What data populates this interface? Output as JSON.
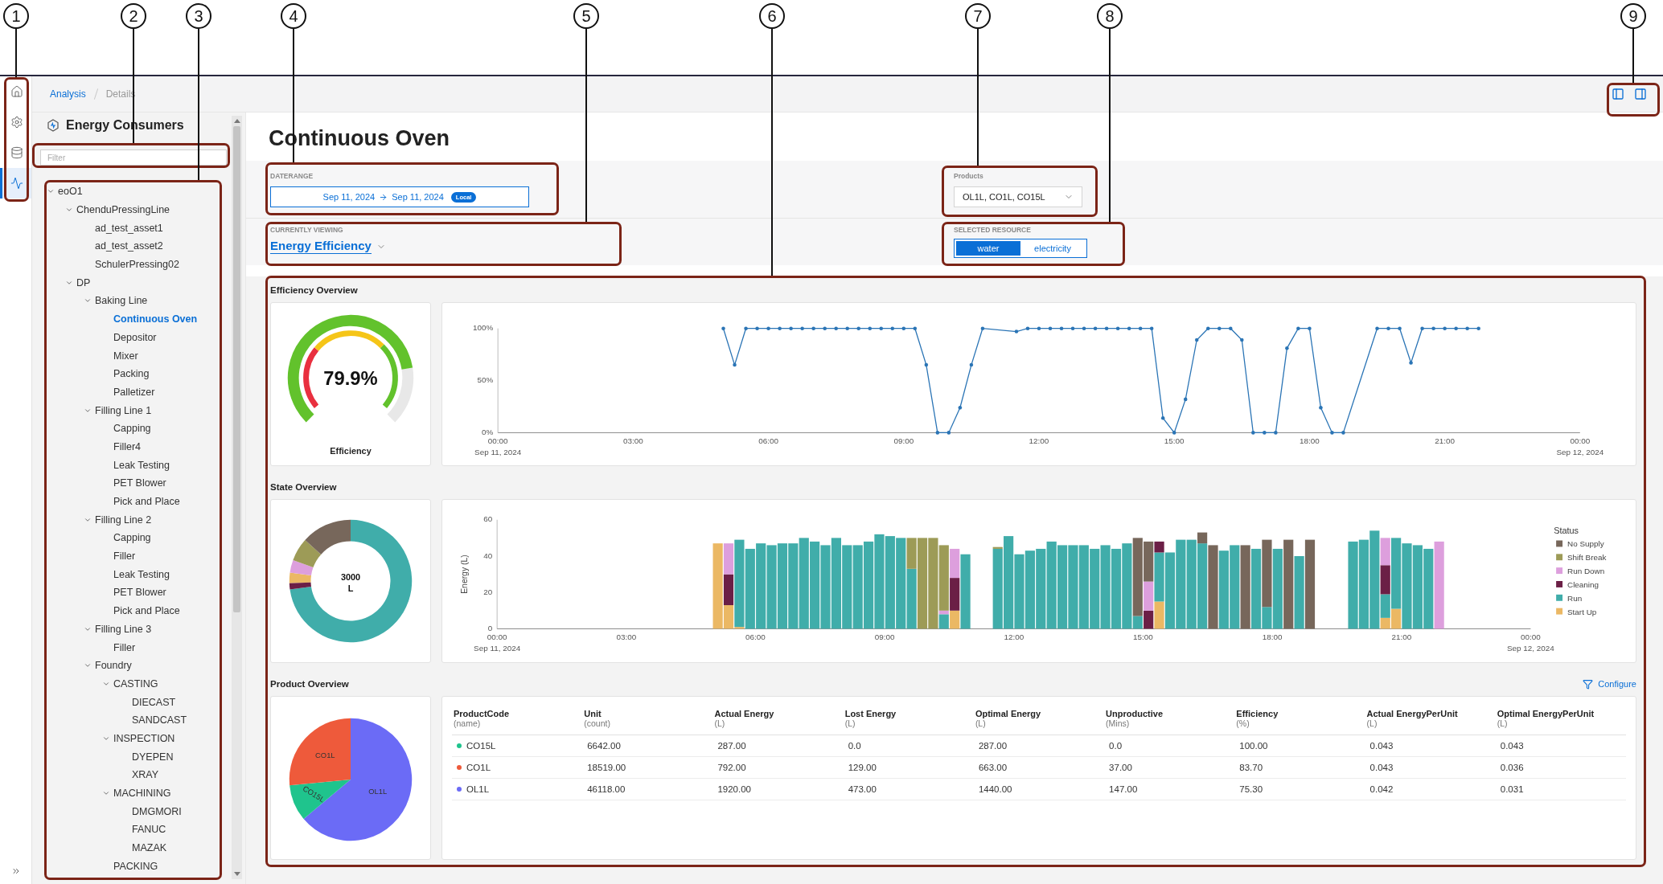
{
  "callouts": [
    {
      "number": "1"
    },
    {
      "number": "2"
    },
    {
      "number": "3"
    },
    {
      "number": "4"
    },
    {
      "number": "5"
    },
    {
      "number": "6"
    },
    {
      "number": "7"
    },
    {
      "number": "8"
    },
    {
      "number": "9"
    }
  ],
  "nav_rail": {
    "items": [
      {
        "selected": false
      },
      {
        "selected": false
      },
      {
        "selected": false
      },
      {
        "selected": true
      }
    ]
  },
  "breadcrumb": [
    {
      "label": "Analysis",
      "current": false
    },
    {
      "label": "Details",
      "current": true
    }
  ],
  "sidebar": {
    "title": "Energy Consumers",
    "filter": {
      "placeholder": "Filter"
    },
    "tree": [
      {
        "label": "eoO1",
        "expanded": true,
        "selected": false,
        "children": [
          {
            "label": "ChenduPressingLine",
            "expanded": true,
            "selected": false,
            "children": [
              {
                "label": "ad_test_asset1",
                "selected": false
              },
              {
                "label": "ad_test_asset2",
                "selected": false
              },
              {
                "label": "SchulerPressing02",
                "selected": false
              }
            ]
          },
          {
            "label": "DP",
            "expanded": true,
            "selected": false,
            "children": [
              {
                "label": "Baking Line",
                "expanded": true,
                "selected": false,
                "children": [
                  {
                    "label": "Continuous Oven",
                    "selected": true
                  },
                  {
                    "label": "Depositor",
                    "selected": false
                  },
                  {
                    "label": "Mixer",
                    "selected": false
                  },
                  {
                    "label": "Packing",
                    "selected": false
                  },
                  {
                    "label": "Palletizer",
                    "selected": false
                  }
                ]
              },
              {
                "label": "Filling Line 1",
                "expanded": true,
                "selected": false,
                "children": [
                  {
                    "label": "Capping",
                    "selected": false
                  },
                  {
                    "label": "Filler4",
                    "selected": false
                  },
                  {
                    "label": "Leak Testing",
                    "selected": false
                  },
                  {
                    "label": "PET Blower",
                    "selected": false
                  },
                  {
                    "label": "Pick and Place",
                    "selected": false
                  }
                ]
              },
              {
                "label": "Filling Line 2",
                "expanded": true,
                "selected": false,
                "children": [
                  {
                    "label": "Capping",
                    "selected": false
                  },
                  {
                    "label": "Filler",
                    "selected": false
                  },
                  {
                    "label": "Leak Testing",
                    "selected": false
                  },
                  {
                    "label": "PET Blower",
                    "selected": false
                  },
                  {
                    "label": "Pick and Place",
                    "selected": false
                  }
                ]
              },
              {
                "label": "Filling Line 3",
                "expanded": true,
                "selected": false,
                "children": [
                  {
                    "label": "Filler",
                    "selected": false
                  }
                ]
              },
              {
                "label": "Foundry",
                "expanded": true,
                "selected": false,
                "children": [
                  {
                    "label": "CASTING",
                    "expanded": true,
                    "selected": false,
                    "children": [
                      {
                        "label": "DIECAST",
                        "selected": false
                      },
                      {
                        "label": "SANDCAST",
                        "selected": false
                      }
                    ]
                  },
                  {
                    "label": "INSPECTION",
                    "expanded": true,
                    "selected": false,
                    "children": [
                      {
                        "label": "DYEPEN",
                        "selected": false
                      },
                      {
                        "label": "XRAY",
                        "selected": false
                      }
                    ]
                  },
                  {
                    "label": "MACHINING",
                    "expanded": true,
                    "selected": false,
                    "children": [
                      {
                        "label": "DMGMORI",
                        "selected": false
                      },
                      {
                        "label": "FANUC",
                        "selected": false
                      },
                      {
                        "label": "MAZAK",
                        "selected": false
                      }
                    ]
                  },
                  {
                    "label": "PACKING",
                    "selected": false
                  }
                ]
              }
            ]
          }
        ]
      }
    ]
  },
  "page": {
    "title": "Continuous Oven"
  },
  "filters": {
    "daterange": {
      "label": "DATERANGE",
      "start": "Sep 11, 2024",
      "end": "Sep 11, 2024",
      "badge": "Local"
    },
    "products": {
      "label": "Products",
      "value": "OL1L, CO1L, CO15L"
    },
    "viewing": {
      "label": "CURRENTLY VIEWING",
      "value": "Energy Efficiency"
    },
    "resource": {
      "label": "SELECTED RESOURCE",
      "options": [
        {
          "label": "water",
          "selected": true
        },
        {
          "label": "electricity",
          "selected": false
        }
      ]
    }
  },
  "efficiency_overview": {
    "title": "Efficiency Overview",
    "gauge": {
      "value": "79.9%",
      "label": "Efficiency"
    },
    "date_labels": [
      "Sep 11, 2024",
      "Sep 12, 2024"
    ],
    "chart_data": {
      "type": "line",
      "xlim": [
        0,
        24
      ],
      "ylim": [
        0,
        100
      ],
      "xticks": [
        {
          "value": 0,
          "label": "00:00"
        },
        {
          "value": 3,
          "label": "03:00"
        },
        {
          "value": 6,
          "label": "06:00"
        },
        {
          "value": 9,
          "label": "09:00"
        },
        {
          "value": 12,
          "label": "12:00"
        },
        {
          "value": 15,
          "label": "15:00"
        },
        {
          "value": 18,
          "label": "18:00"
        },
        {
          "value": 21,
          "label": "21:00"
        },
        {
          "value": 24,
          "label": "00:00"
        }
      ],
      "yticks": [
        {
          "value": 0,
          "label": "0%"
        },
        {
          "value": 50,
          "label": "50%"
        },
        {
          "value": 100,
          "label": "100%"
        }
      ],
      "x": [
        5,
        5.25,
        5.5,
        5.75,
        6,
        6.25,
        6.5,
        6.75,
        7,
        7.25,
        7.5,
        7.75,
        8,
        8.25,
        8.5,
        8.75,
        9,
        9.25,
        9.5,
        9.75,
        10,
        10.25,
        10.5,
        10.75,
        11.5,
        11.75,
        12,
        12.25,
        12.5,
        12.75,
        13,
        13.25,
        13.5,
        13.75,
        14,
        14.25,
        14.5,
        14.75,
        15,
        15.25,
        15.5,
        15.75,
        16,
        16.25,
        16.5,
        16.75,
        17,
        17.25,
        17.5,
        17.75,
        18,
        18.25,
        18.5,
        18.75,
        19.5,
        19.75,
        20,
        20.25,
        20.5,
        20.75,
        21,
        21.25,
        21.5,
        21.75
      ],
      "series": [
        {
          "color": "#2a74b5",
          "values": [
            100,
            65,
            100,
            100,
            100,
            100,
            100,
            100,
            100,
            100,
            100,
            100,
            100,
            100,
            100,
            100,
            100,
            100,
            65,
            0,
            0,
            24,
            65,
            100,
            97,
            100,
            100,
            100,
            100,
            100,
            100,
            100,
            100,
            100,
            100,
            100,
            100,
            14,
            0,
            32,
            89,
            100,
            100,
            100,
            89,
            0,
            0,
            0,
            81,
            100,
            100,
            24,
            0,
            0,
            100,
            100,
            100,
            67,
            100,
            100,
            100,
            100,
            100,
            100
          ]
        }
      ]
    }
  },
  "state_overview": {
    "title": "State Overview",
    "donut": {
      "value": "3000",
      "unit": "L"
    },
    "date_labels": [
      "Sep 11, 2024",
      "Sep 12, 2024"
    ],
    "chart_data": {
      "type": "bar",
      "stacked": true,
      "ylabel": "Energy (L)",
      "legend": {
        "title": "Status"
      },
      "xlim": [
        0,
        24
      ],
      "ylim": [
        0,
        60
      ],
      "xticks": [
        {
          "value": 0,
          "label": "00:00"
        },
        {
          "value": 3,
          "label": "03:00"
        },
        {
          "value": 6,
          "label": "06:00"
        },
        {
          "value": 9,
          "label": "09:00"
        },
        {
          "value": 12,
          "label": "12:00"
        },
        {
          "value": 15,
          "label": "15:00"
        },
        {
          "value": 18,
          "label": "18:00"
        },
        {
          "value": 21,
          "label": "21:00"
        },
        {
          "value": 24,
          "label": "00:00"
        }
      ],
      "yticks": [
        0,
        20,
        40,
        60
      ],
      "x": [
        5.125,
        5.375,
        5.625,
        5.875,
        6.125,
        6.375,
        6.625,
        6.875,
        7.125,
        7.375,
        7.625,
        7.875,
        8.125,
        8.375,
        8.625,
        8.875,
        9.125,
        9.375,
        9.625,
        9.875,
        10.125,
        10.375,
        10.625,
        10.875,
        11.625,
        11.875,
        12.125,
        12.375,
        12.625,
        12.875,
        13.125,
        13.375,
        13.625,
        13.875,
        14.125,
        14.375,
        14.625,
        14.875,
        15.125,
        15.375,
        15.625,
        15.875,
        16.125,
        16.375,
        16.625,
        16.875,
        17.125,
        17.375,
        17.625,
        17.875,
        18.125,
        18.375,
        18.625,
        18.875,
        19.875,
        20.125,
        20.375,
        20.625,
        20.875,
        21.125,
        21.375,
        21.625,
        21.875
      ],
      "series": [
        {
          "name": "Start Up",
          "color": "#ebb864",
          "values": [
            47,
            13,
            1,
            0,
            0,
            0,
            0,
            0,
            0,
            0,
            0,
            0,
            0,
            0,
            0,
            0,
            0,
            0,
            0,
            0,
            0,
            0,
            10,
            0,
            0,
            0,
            0,
            0,
            0,
            0,
            0,
            0,
            0,
            0,
            0,
            0,
            0,
            0,
            0,
            15,
            0,
            0,
            0,
            0,
            0,
            0,
            0,
            0,
            0,
            0,
            0,
            0,
            0,
            0,
            0,
            0,
            0,
            6,
            11,
            0,
            0,
            0,
            0
          ]
        },
        {
          "name": "Run",
          "color": "#40adaa",
          "values": [
            0,
            0,
            48,
            44,
            47,
            46,
            47,
            47,
            50,
            48,
            46,
            50,
            46,
            46,
            48,
            52,
            51,
            50,
            33,
            0,
            0,
            8,
            0,
            41,
            44,
            51,
            41,
            43,
            44,
            48,
            46,
            46,
            46,
            44,
            46,
            44,
            47,
            7,
            0,
            27,
            42,
            49,
            49,
            47,
            0,
            43,
            46,
            0,
            44,
            12,
            44,
            0,
            40,
            0,
            48,
            49,
            54,
            13,
            39,
            47,
            46,
            44,
            0
          ]
        },
        {
          "name": "Cleaning",
          "color": "#6b1f46",
          "values": [
            0,
            17,
            0,
            0,
            0,
            0,
            0,
            0,
            0,
            0,
            0,
            0,
            0,
            0,
            0,
            0,
            0,
            0,
            0,
            0,
            0,
            0,
            18,
            0,
            0,
            0,
            0,
            0,
            0,
            0,
            0,
            0,
            0,
            0,
            0,
            0,
            0,
            0,
            10,
            6,
            0,
            0,
            0,
            0,
            0,
            0,
            0,
            0,
            0,
            0,
            0,
            0,
            0,
            0,
            0,
            0,
            0,
            16,
            0,
            0,
            0,
            0,
            0
          ]
        },
        {
          "name": "Run Down",
          "color": "#dd9fdd",
          "values": [
            0,
            17,
            0,
            0,
            0,
            0,
            0,
            0,
            0,
            0,
            0,
            0,
            0,
            0,
            0,
            0,
            0,
            0,
            0,
            0,
            0,
            2,
            16,
            0,
            0,
            0,
            0,
            0,
            0,
            0,
            0,
            0,
            0,
            0,
            0,
            0,
            0,
            0,
            16,
            0,
            0,
            0,
            0,
            0,
            0,
            0,
            0,
            0,
            0,
            0,
            0,
            0,
            0,
            0,
            0,
            0,
            0,
            15,
            0,
            0,
            0,
            0,
            48
          ]
        },
        {
          "name": "Shift Break",
          "color": "#9d9b57",
          "values": [
            0,
            0,
            0,
            0,
            0,
            0,
            0,
            0,
            0,
            0,
            0,
            0,
            0,
            0,
            0,
            0,
            0,
            0,
            17,
            50,
            50,
            36,
            0,
            0,
            1,
            0,
            0,
            0,
            0,
            0,
            0,
            0,
            0,
            0,
            0,
            0,
            0,
            0,
            0,
            0,
            0,
            0,
            0,
            0,
            0,
            0,
            0,
            0,
            0,
            0,
            0,
            0,
            0,
            0,
            0,
            0,
            0,
            0,
            0,
            0,
            0,
            0,
            0
          ]
        },
        {
          "name": "No Supply",
          "color": "#77675b",
          "values": [
            0,
            0,
            0,
            0,
            0,
            0,
            0,
            0,
            0,
            0,
            0,
            0,
            0,
            0,
            0,
            0,
            0,
            0,
            0,
            0,
            0,
            0,
            0,
            0,
            0,
            0,
            0,
            0,
            0,
            0,
            0,
            0,
            0,
            0,
            0,
            0,
            0,
            43,
            22,
            0,
            0,
            0,
            0,
            6,
            46,
            0,
            0,
            46,
            0,
            37,
            0,
            49,
            0,
            49,
            0,
            0,
            0,
            0,
            0,
            0,
            0,
            0,
            0
          ]
        }
      ]
    }
  },
  "product_overview": {
    "title": "Product Overview",
    "configure": "Configure",
    "pie": {
      "slices": [
        {
          "label": "OL1L",
          "color": "#6b6bf6"
        },
        {
          "label": "CO15L",
          "color": "#1fc48d"
        },
        {
          "label": "CO1L",
          "color": "#ee5a3b"
        }
      ]
    },
    "table": {
      "columns": [
        {
          "name": "ProductCode",
          "unit": "(name)"
        },
        {
          "name": "Unit",
          "unit": "(count)"
        },
        {
          "name": "Actual Energy",
          "unit": "(L)"
        },
        {
          "name": "Lost Energy",
          "unit": "(L)"
        },
        {
          "name": "Optimal Energy",
          "unit": "(L)"
        },
        {
          "name": "Unproductive",
          "unit": "(Mins)"
        },
        {
          "name": "Efficiency",
          "unit": "(%)"
        },
        {
          "name": "Actual EnergyPerUnit",
          "unit": "(L)"
        },
        {
          "name": "Optimal EnergyPerUnit",
          "unit": "(L)"
        }
      ],
      "rows": [
        {
          "color": "#1fc48d",
          "cells": [
            "CO15L",
            "6642.00",
            "287.00",
            "0.0",
            "287.00",
            "0.0",
            "100.00",
            "0.043",
            "0.043"
          ]
        },
        {
          "color": "#ee5a3b",
          "cells": [
            "CO1L",
            "18519.00",
            "792.00",
            "129.00",
            "663.00",
            "37.00",
            "83.70",
            "0.043",
            "0.036"
          ]
        },
        {
          "color": "#6b6bf6",
          "cells": [
            "OL1L",
            "46118.00",
            "1920.00",
            "473.00",
            "1440.00",
            "147.00",
            "75.30",
            "0.042",
            "0.031"
          ]
        }
      ]
    }
  }
}
